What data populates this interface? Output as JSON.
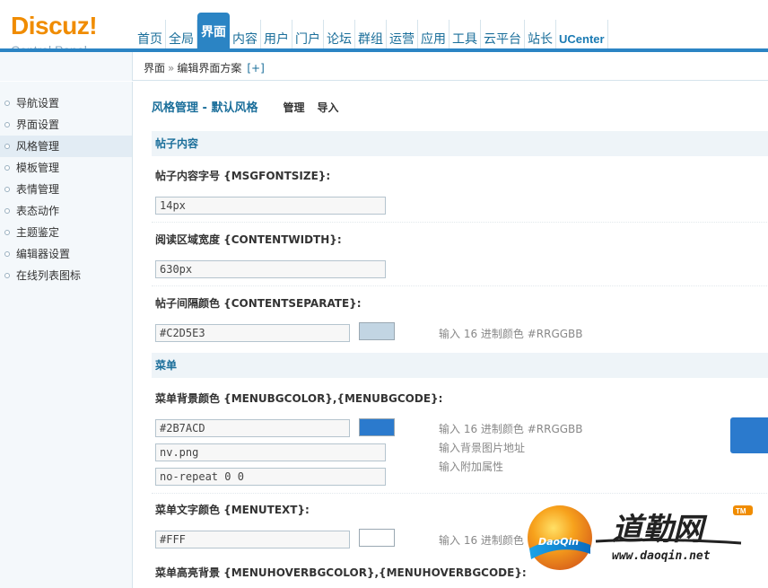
{
  "logo": {
    "brand": "Discuz!",
    "subtitle": "Control Panel"
  },
  "nav": {
    "items": [
      "首页",
      "全局",
      "界面",
      "内容",
      "用户",
      "门户",
      "论坛",
      "群组",
      "运营",
      "应用",
      "工具",
      "云平台",
      "站长",
      "UCenter"
    ],
    "active_index": 2
  },
  "breadcrumb": {
    "part1": "界面",
    "sep": "»",
    "part2": "编辑界面方案",
    "add": "[+]"
  },
  "sidebar": {
    "items": [
      "导航设置",
      "界面设置",
      "风格管理",
      "模板管理",
      "表情管理",
      "表态动作",
      "主题鉴定",
      "编辑器设置",
      "在线列表图标"
    ],
    "active_index": 2
  },
  "page": {
    "title": "风格管理 - 默认风格",
    "tabs": [
      "管理",
      "导入"
    ]
  },
  "sections": {
    "post_content": "帖子内容",
    "menu": "菜单"
  },
  "fields": {
    "msgfontsize": {
      "label": "帖子内容字号 {MSGFONTSIZE}:",
      "value": "14px"
    },
    "contentwidth": {
      "label": "阅读区域宽度 {CONTENTWIDTH}:",
      "value": "630px"
    },
    "contentseparate": {
      "label": "帖子间隔颜色 {CONTENTSEPARATE}:",
      "value": "#C2D5E3",
      "swatch": "#C2D5E3",
      "hint": "输入 16 进制颜色 #RRGGBB"
    },
    "menubg": {
      "label": "菜单背景颜色 {MENUBGCOLOR},{MENUBGCODE}:",
      "color": "#2B7ACD",
      "image": "nv.png",
      "extra": "no-repeat 0 0",
      "swatch": "#2B7ACD",
      "hint_color": "输入 16 进制颜色 #RRGGBB",
      "hint_image": "输入背景图片地址",
      "hint_extra": "输入附加属性"
    },
    "menutext": {
      "label": "菜单文字颜色 {MENUTEXT}:",
      "value": "#FFF",
      "swatch": "#FFFFFF",
      "hint": "输入 16 进制颜色 #RRGGBB"
    },
    "menuhover": {
      "label": "菜单高亮背景 {MENUHOVERBGCOLOR},{MENUHOVERBGCODE}:"
    }
  },
  "watermark": {
    "badge": "DaoQin",
    "brand": "道勤网",
    "tm": "TM",
    "url": "www.daoqin.net"
  }
}
